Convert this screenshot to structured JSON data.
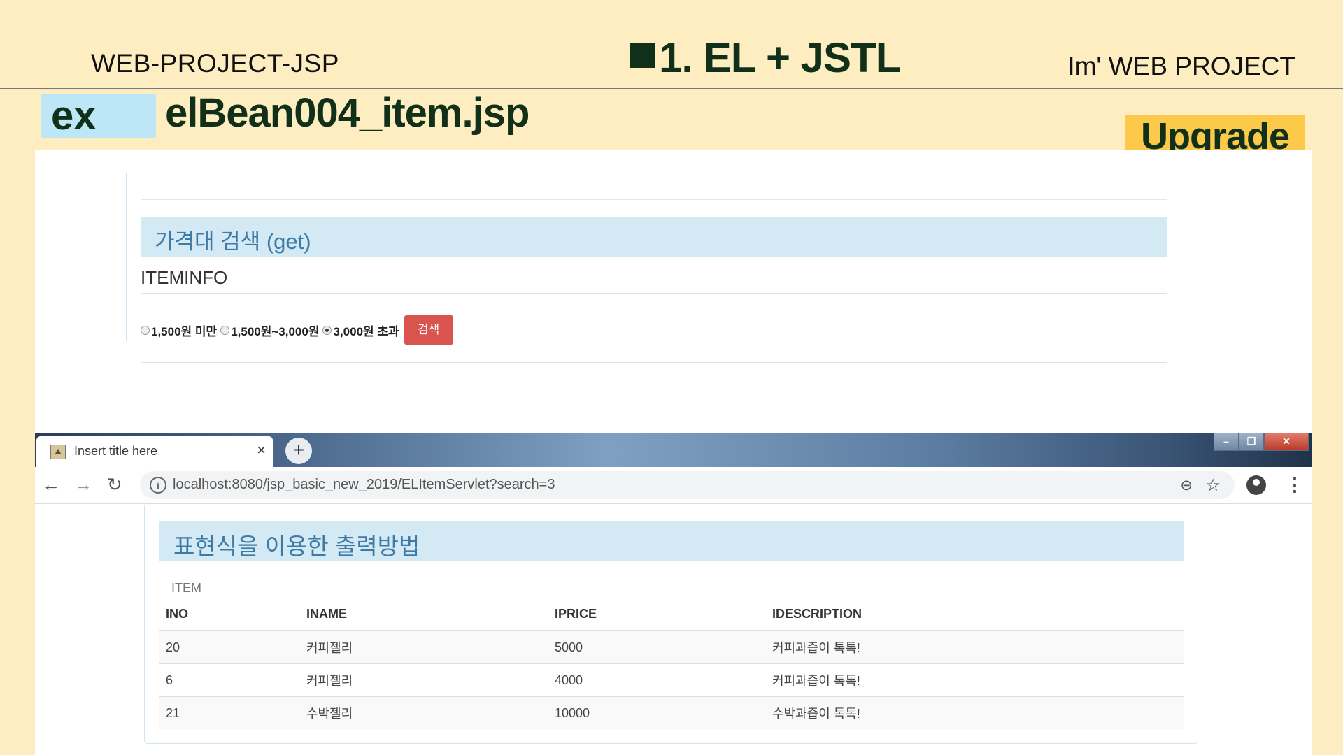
{
  "slide": {
    "left_title": "WEB-PROJECT-JSP",
    "center_title": "1. EL + JSTL",
    "right_title": "Im'  WEB PROJECT",
    "ex_label": "ex",
    "file_title": "elBean004_item.jsp",
    "upgrade_label": "Upgrade"
  },
  "form_page": {
    "heading": "가격대 검색 (get)",
    "subtitle": "ITEMINFO",
    "radio_options": [
      {
        "label": "1,500원 미만",
        "checked": false
      },
      {
        "label": "1,500원~3,000원",
        "checked": false
      },
      {
        "label": "3,000원 초과",
        "checked": true
      }
    ],
    "search_button": "검색"
  },
  "browser": {
    "tab_title": "Insert title here",
    "tab_close": "×",
    "new_tab": "+",
    "url": "localhost:8080/jsp_basic_new_2019/ELItemServlet?search=3",
    "icons": {
      "back": "back-arrow-icon",
      "forward": "forward-arrow-icon",
      "reload": "reload-icon",
      "info": "info-icon",
      "zoom": "zoom-icon",
      "star": "star-icon",
      "account": "account-icon",
      "menu": "menu-icon"
    }
  },
  "result_page": {
    "heading": "표현식을 이용한 출력방법",
    "caption": "ITEM",
    "columns": [
      "INO",
      "INAME",
      "IPRICE",
      "IDESCRIPTION"
    ],
    "rows": [
      [
        "20",
        "커피젤리",
        "5000",
        "커피과즙이 톡톡!"
      ],
      [
        "6",
        "커피젤리",
        "4000",
        "커피과즙이 톡톡!"
      ],
      [
        "21",
        "수박젤리",
        "10000",
        "수박과즙이 톡톡!"
      ]
    ]
  },
  "colors": {
    "slide_bg": "#fdedc0",
    "title_dark": "#10301a",
    "ex_badge": "#bde6f7",
    "upgrade_badge": "#fcc94a",
    "heading_bg": "#d3e9f4",
    "heading_text": "#3d7aa5",
    "danger_button": "#d9534f"
  }
}
